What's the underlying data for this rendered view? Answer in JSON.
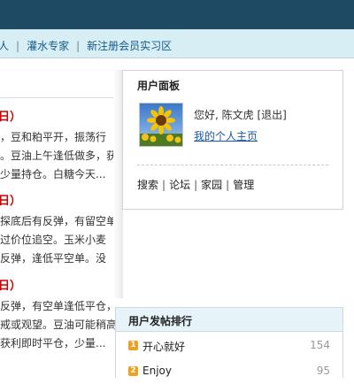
{
  "subnav": {
    "items": [
      "人",
      "灌水专家",
      "新注册会员实习区"
    ]
  },
  "left_column": {
    "entries": [
      {
        "date": "日）",
        "lines": [
          "，豆和粕平开，振荡行",
          "。豆油上午逢低做多，获",
          "少量持仓。白糖今天..."
        ]
      },
      {
        "date": "日）",
        "lines": [
          "探底后有反弹，有留空单",
          "过价位追空。玉米小麦",
          "反弹，逢低平空单。没"
        ]
      },
      {
        "date": "日）",
        "lines": [
          "反弹，有空单逢低平仓，",
          "戒或观望。豆油可能稍高",
          "获利即时平仓，少量..."
        ]
      }
    ]
  },
  "user_panel": {
    "title": "用户面板",
    "greeting": "您好, 陈文虎",
    "logout": "[退出]",
    "home_link": "我的个人主页",
    "links": [
      "搜索",
      "论坛",
      "家园",
      "管理"
    ]
  },
  "ranking": {
    "title": "用户发帖排行",
    "rows": [
      {
        "rank": "1",
        "name": "开心就好",
        "count": "154"
      },
      {
        "rank": "2",
        "name": "Enjoy",
        "count": "95"
      }
    ]
  },
  "colors": {
    "topbar": "#1f4a63",
    "subnav": "#d6eef4",
    "accent_red": "#cc0000",
    "link_blue": "#1a57a6",
    "rank_badge": "#f0a020"
  }
}
